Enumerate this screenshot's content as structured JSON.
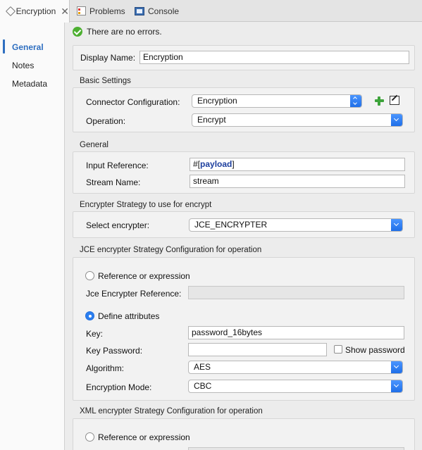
{
  "tabs": [
    {
      "label": "Encryption",
      "active": true
    },
    {
      "label": "Problems",
      "active": false
    },
    {
      "label": "Console",
      "active": false
    }
  ],
  "nav": {
    "items": [
      {
        "label": "General",
        "active": true
      },
      {
        "label": "Notes",
        "active": false
      },
      {
        "label": "Metadata",
        "active": false
      }
    ]
  },
  "status": {
    "text": "There are no errors."
  },
  "display_name": {
    "label": "Display Name:",
    "value": "Encryption"
  },
  "basic": {
    "title": "Basic Settings",
    "connector_label": "Connector Configuration:",
    "connector_value": "Encryption",
    "operation_label": "Operation:",
    "operation_value": "Encrypt"
  },
  "general": {
    "title": "General",
    "input_ref_label": "Input Reference:",
    "input_ref_prefix": "#[",
    "input_ref_token": "payload",
    "input_ref_suffix": "]",
    "stream_label": "Stream Name:",
    "stream_value": "stream"
  },
  "strategy": {
    "title": "Encrypter Strategy to use for encrypt",
    "select_label": "Select encrypter:",
    "select_value": "JCE_ENCRYPTER"
  },
  "jce": {
    "title": "JCE encrypter Strategy Configuration for operation",
    "ref_radio_label": "Reference or expression",
    "ref_field_label": "Jce Encrypter Reference:",
    "ref_field_value": "",
    "define_radio_label": "Define attributes",
    "key_label": "Key:",
    "key_value": "password_16bytes",
    "key_password_label": "Key Password:",
    "key_password_value": "",
    "show_password_label": "Show password",
    "algorithm_label": "Algorithm:",
    "algorithm_value": "AES",
    "mode_label": "Encryption Mode:",
    "mode_value": "CBC"
  },
  "xml": {
    "title": "XML encrypter Strategy Configuration for operation",
    "ref_radio_label": "Reference or expression"
  },
  "colors": {
    "accent": "#2f6fc0",
    "success": "#4caf30",
    "select_button": "#2a7ef0"
  }
}
